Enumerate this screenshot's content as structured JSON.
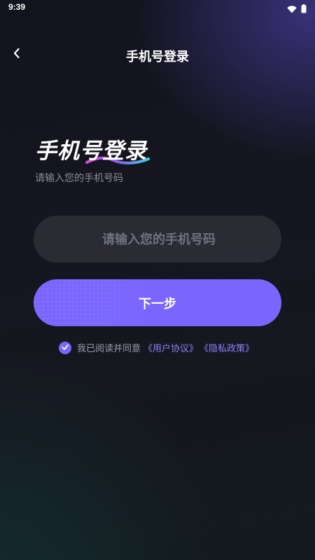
{
  "status_bar": {
    "time": "9:39",
    "icons": [
      "wifi-icon",
      "battery-icon"
    ]
  },
  "nav": {
    "back_icon": "chevron-left-icon",
    "title": "手机号登录"
  },
  "heading": {
    "title": "手机号登录",
    "subtitle": "请输入您的手机号码"
  },
  "phone_input": {
    "value": "",
    "placeholder": "请输入您的手机号码"
  },
  "next_button": {
    "label": "下一步"
  },
  "agreement": {
    "checked": true,
    "text": "我已阅读并同意",
    "user_agreement_link": "《用户协议》",
    "privacy_policy_link": "《隐私政策》"
  },
  "colors": {
    "accent": "#7a66ff",
    "link": "#8e7fff",
    "muted_text": "#8a8d97",
    "input_bg": "rgba(255,255,255,0.09)",
    "underline_start": "#e04bd8",
    "underline_end": "#3fd4e8"
  }
}
